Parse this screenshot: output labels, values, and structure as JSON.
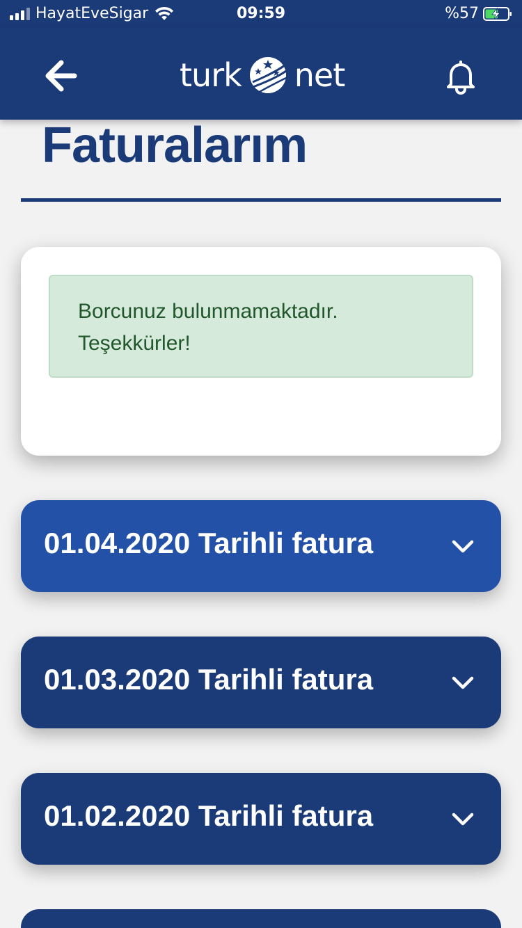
{
  "status_bar": {
    "carrier": "HayatEveSigar",
    "time": "09:59",
    "battery": "%57",
    "battery_level": 0.57
  },
  "header": {
    "logo_left": "turk",
    "logo_right": "net",
    "back_icon": "arrow-left-icon",
    "bell_icon": "bell-icon"
  },
  "page": {
    "title": "Faturalarım"
  },
  "notice": {
    "line1": "Borcunuz bulunmamaktadır.",
    "line2": "Teşekkürler!"
  },
  "invoices": [
    {
      "label": "01.04.2020 Tarihli fatura",
      "color": "#2351a8"
    },
    {
      "label": "01.03.2020 Tarihli fatura",
      "color": "#1b3a78"
    },
    {
      "label": "01.02.2020 Tarihli fatura",
      "color": "#1b3a78"
    },
    {
      "label": "",
      "color": "#1b3a78"
    }
  ],
  "colors": {
    "brand_navy": "#1b3a78",
    "active_blue": "#2351a8",
    "success_bg": "#d6eadb",
    "success_text": "#22572c"
  }
}
